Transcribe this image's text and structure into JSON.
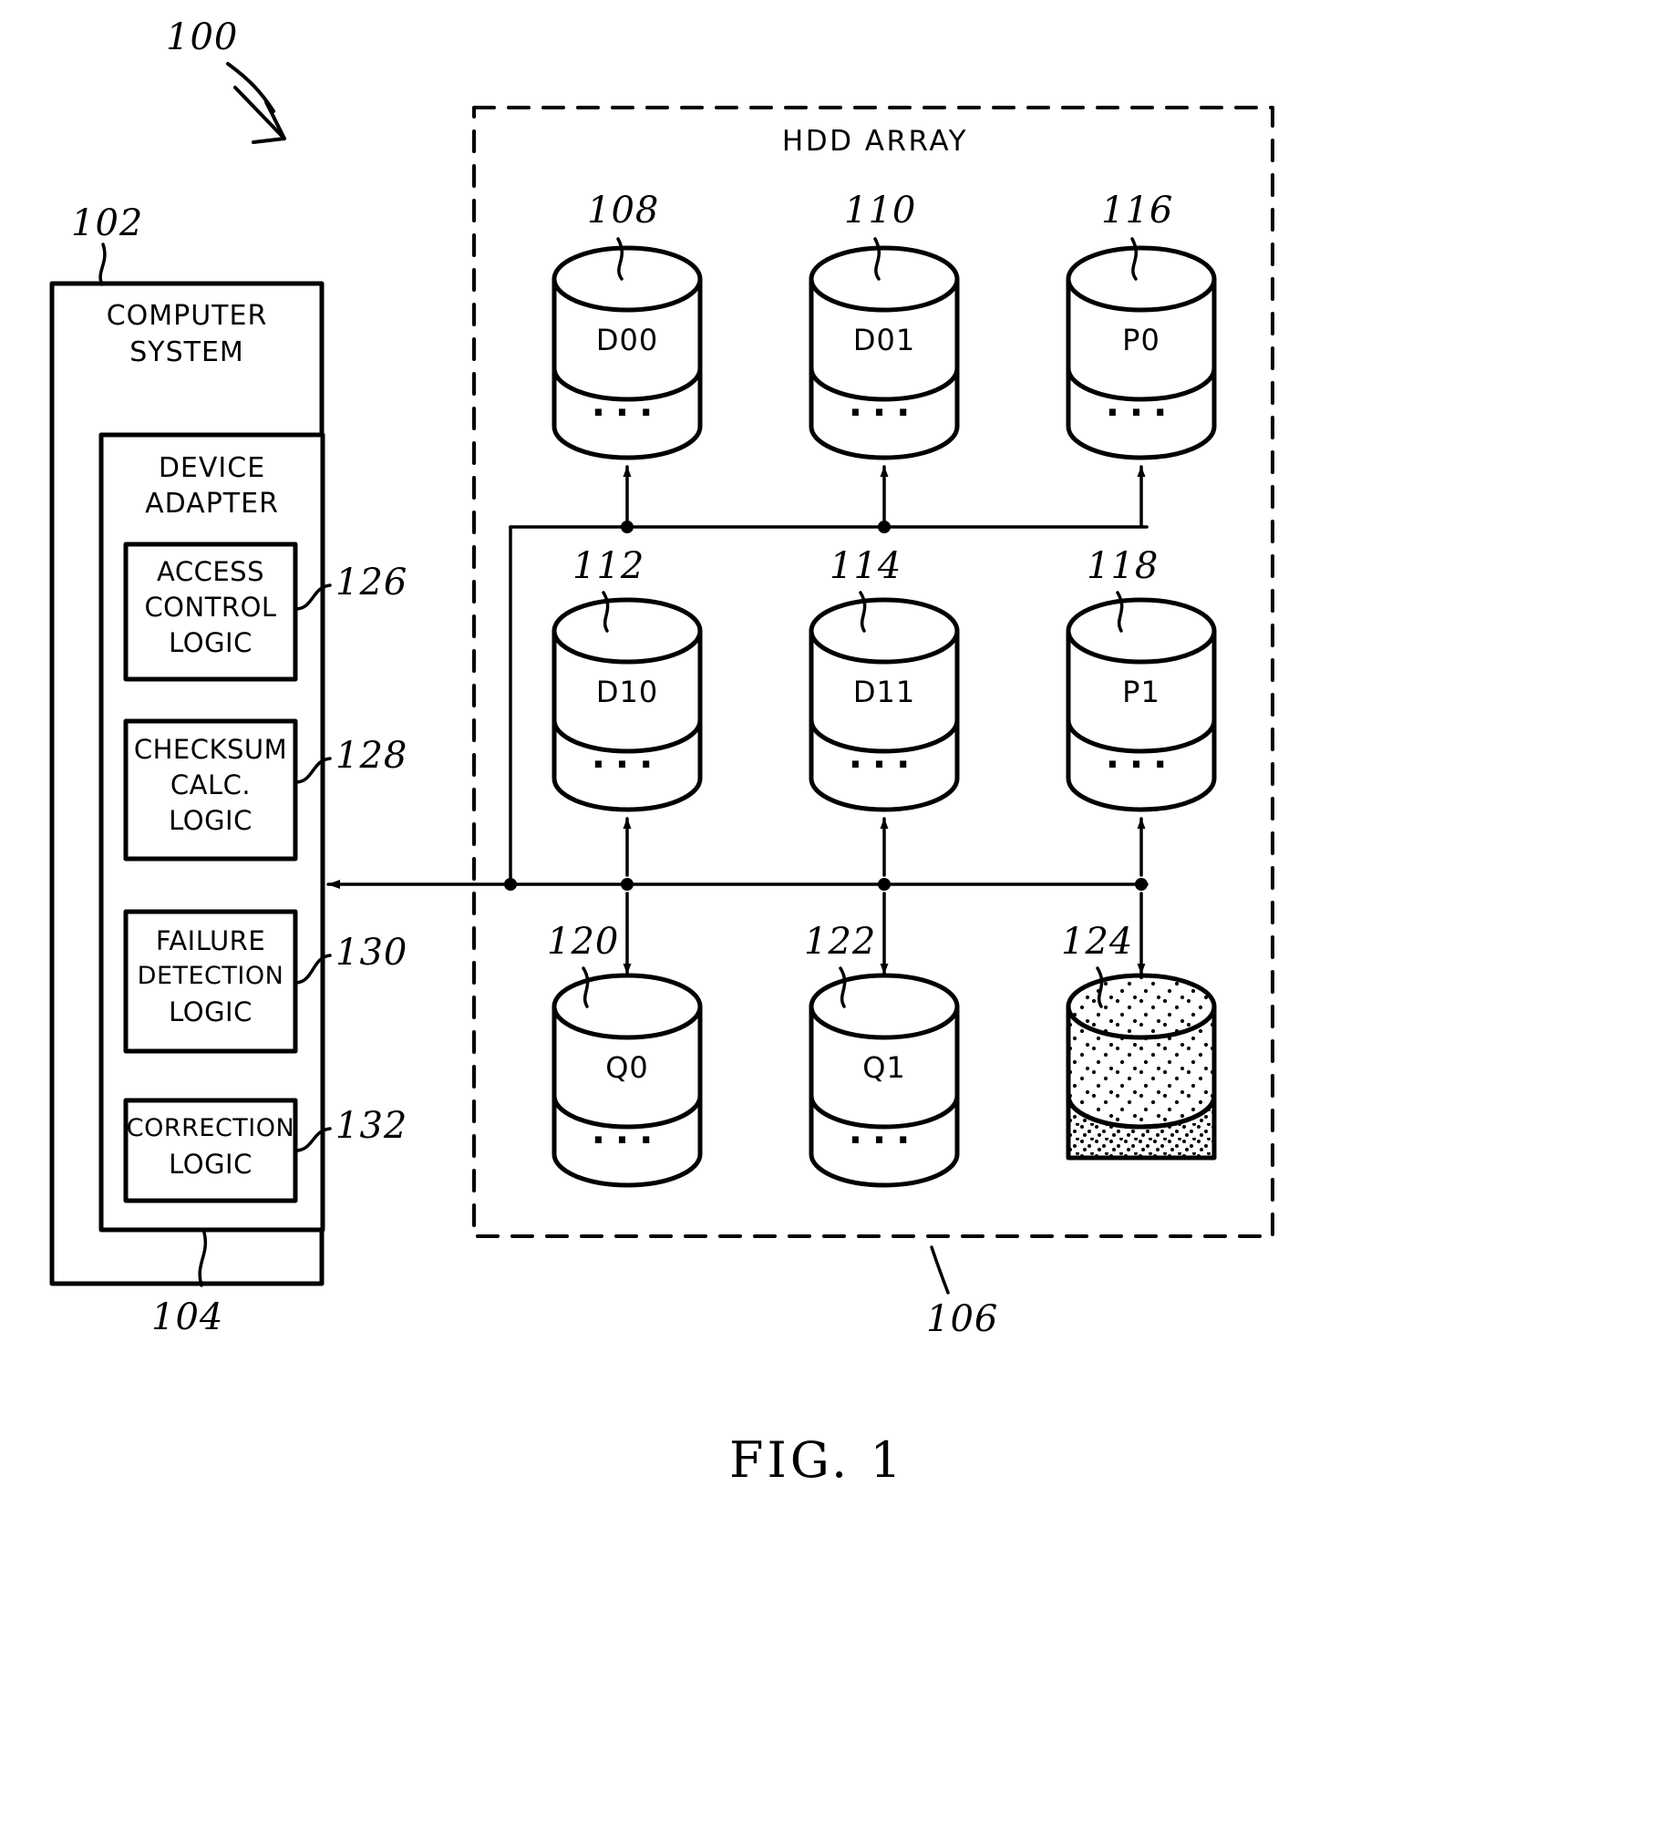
{
  "figure": {
    "caption": "FIG. 1",
    "system_ref": "100"
  },
  "computer_system": {
    "ref": "102",
    "title_line1": "COMPUTER",
    "title_line2": "SYSTEM"
  },
  "device_adapter": {
    "ref": "104",
    "title_line1": "DEVICE",
    "title_line2": "ADAPTER",
    "modules": [
      {
        "ref": "126",
        "lines": [
          "ACCESS",
          "CONTROL",
          "LOGIC"
        ]
      },
      {
        "ref": "128",
        "lines": [
          "CHECKSUM",
          "CALC.",
          "LOGIC"
        ]
      },
      {
        "ref": "130",
        "lines": [
          "FAILURE",
          "DETECTION",
          "LOGIC"
        ]
      },
      {
        "ref": "132",
        "lines": [
          "CORRECTION",
          "LOGIC"
        ]
      }
    ]
  },
  "hdd_array": {
    "title": "HDD ARRAY",
    "ref": "106",
    "disks": [
      {
        "ref": "108",
        "label": "D00",
        "row": 1,
        "col": 1,
        "fill": "plain",
        "dots": "..."
      },
      {
        "ref": "110",
        "label": "D01",
        "row": 1,
        "col": 2,
        "fill": "plain",
        "dots": "..."
      },
      {
        "ref": "116",
        "label": "P0",
        "row": 1,
        "col": 3,
        "fill": "plain",
        "dots": "..."
      },
      {
        "ref": "112",
        "label": "D10",
        "row": 2,
        "col": 1,
        "fill": "plain",
        "dots": "..."
      },
      {
        "ref": "114",
        "label": "D11",
        "row": 2,
        "col": 2,
        "fill": "plain",
        "dots": "..."
      },
      {
        "ref": "118",
        "label": "P1",
        "row": 2,
        "col": 3,
        "fill": "plain",
        "dots": "..."
      },
      {
        "ref": "120",
        "label": "Q0",
        "row": 3,
        "col": 1,
        "fill": "plain",
        "dots": "..."
      },
      {
        "ref": "122",
        "label": "Q1",
        "row": 3,
        "col": 2,
        "fill": "plain",
        "dots": "..."
      },
      {
        "ref": "124",
        "label": "",
        "row": 3,
        "col": 3,
        "fill": "stippled",
        "dots": ""
      }
    ]
  },
  "colors": {
    "ink": "#000000",
    "paper": "#ffffff"
  }
}
